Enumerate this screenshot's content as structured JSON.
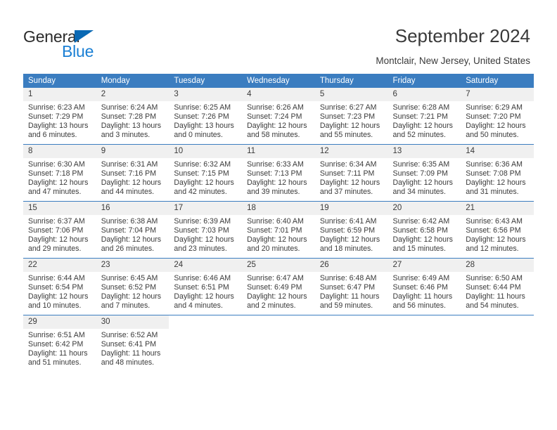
{
  "brand": {
    "name_part1": "General",
    "name_part2": "Blue",
    "triangle_icon": "triangle-icon",
    "accent_color": "#1a7fd4",
    "dark_color": "#2b2b2b"
  },
  "header": {
    "title": "September 2024",
    "subtitle": "Montclair, New Jersey, United States"
  },
  "theme": {
    "header_bg": "#3b7dc0",
    "daynum_bg": "#f0f0f0",
    "text": "#3a3a3a"
  },
  "weekday_headers": [
    "Sunday",
    "Monday",
    "Tuesday",
    "Wednesday",
    "Thursday",
    "Friday",
    "Saturday"
  ],
  "labels": {
    "sunrise": "Sunrise:",
    "sunset": "Sunset:",
    "daylight": "Daylight:"
  },
  "weeks": [
    [
      {
        "day": "1",
        "sunrise": "Sunrise: 6:23 AM",
        "sunset": "Sunset: 7:29 PM",
        "daylight": "Daylight: 13 hours and 6 minutes."
      },
      {
        "day": "2",
        "sunrise": "Sunrise: 6:24 AM",
        "sunset": "Sunset: 7:28 PM",
        "daylight": "Daylight: 13 hours and 3 minutes."
      },
      {
        "day": "3",
        "sunrise": "Sunrise: 6:25 AM",
        "sunset": "Sunset: 7:26 PM",
        "daylight": "Daylight: 13 hours and 0 minutes."
      },
      {
        "day": "4",
        "sunrise": "Sunrise: 6:26 AM",
        "sunset": "Sunset: 7:24 PM",
        "daylight": "Daylight: 12 hours and 58 minutes."
      },
      {
        "day": "5",
        "sunrise": "Sunrise: 6:27 AM",
        "sunset": "Sunset: 7:23 PM",
        "daylight": "Daylight: 12 hours and 55 minutes."
      },
      {
        "day": "6",
        "sunrise": "Sunrise: 6:28 AM",
        "sunset": "Sunset: 7:21 PM",
        "daylight": "Daylight: 12 hours and 52 minutes."
      },
      {
        "day": "7",
        "sunrise": "Sunrise: 6:29 AM",
        "sunset": "Sunset: 7:20 PM",
        "daylight": "Daylight: 12 hours and 50 minutes."
      }
    ],
    [
      {
        "day": "8",
        "sunrise": "Sunrise: 6:30 AM",
        "sunset": "Sunset: 7:18 PM",
        "daylight": "Daylight: 12 hours and 47 minutes."
      },
      {
        "day": "9",
        "sunrise": "Sunrise: 6:31 AM",
        "sunset": "Sunset: 7:16 PM",
        "daylight": "Daylight: 12 hours and 44 minutes."
      },
      {
        "day": "10",
        "sunrise": "Sunrise: 6:32 AM",
        "sunset": "Sunset: 7:15 PM",
        "daylight": "Daylight: 12 hours and 42 minutes."
      },
      {
        "day": "11",
        "sunrise": "Sunrise: 6:33 AM",
        "sunset": "Sunset: 7:13 PM",
        "daylight": "Daylight: 12 hours and 39 minutes."
      },
      {
        "day": "12",
        "sunrise": "Sunrise: 6:34 AM",
        "sunset": "Sunset: 7:11 PM",
        "daylight": "Daylight: 12 hours and 37 minutes."
      },
      {
        "day": "13",
        "sunrise": "Sunrise: 6:35 AM",
        "sunset": "Sunset: 7:09 PM",
        "daylight": "Daylight: 12 hours and 34 minutes."
      },
      {
        "day": "14",
        "sunrise": "Sunrise: 6:36 AM",
        "sunset": "Sunset: 7:08 PM",
        "daylight": "Daylight: 12 hours and 31 minutes."
      }
    ],
    [
      {
        "day": "15",
        "sunrise": "Sunrise: 6:37 AM",
        "sunset": "Sunset: 7:06 PM",
        "daylight": "Daylight: 12 hours and 29 minutes."
      },
      {
        "day": "16",
        "sunrise": "Sunrise: 6:38 AM",
        "sunset": "Sunset: 7:04 PM",
        "daylight": "Daylight: 12 hours and 26 minutes."
      },
      {
        "day": "17",
        "sunrise": "Sunrise: 6:39 AM",
        "sunset": "Sunset: 7:03 PM",
        "daylight": "Daylight: 12 hours and 23 minutes."
      },
      {
        "day": "18",
        "sunrise": "Sunrise: 6:40 AM",
        "sunset": "Sunset: 7:01 PM",
        "daylight": "Daylight: 12 hours and 20 minutes."
      },
      {
        "day": "19",
        "sunrise": "Sunrise: 6:41 AM",
        "sunset": "Sunset: 6:59 PM",
        "daylight": "Daylight: 12 hours and 18 minutes."
      },
      {
        "day": "20",
        "sunrise": "Sunrise: 6:42 AM",
        "sunset": "Sunset: 6:58 PM",
        "daylight": "Daylight: 12 hours and 15 minutes."
      },
      {
        "day": "21",
        "sunrise": "Sunrise: 6:43 AM",
        "sunset": "Sunset: 6:56 PM",
        "daylight": "Daylight: 12 hours and 12 minutes."
      }
    ],
    [
      {
        "day": "22",
        "sunrise": "Sunrise: 6:44 AM",
        "sunset": "Sunset: 6:54 PM",
        "daylight": "Daylight: 12 hours and 10 minutes."
      },
      {
        "day": "23",
        "sunrise": "Sunrise: 6:45 AM",
        "sunset": "Sunset: 6:52 PM",
        "daylight": "Daylight: 12 hours and 7 minutes."
      },
      {
        "day": "24",
        "sunrise": "Sunrise: 6:46 AM",
        "sunset": "Sunset: 6:51 PM",
        "daylight": "Daylight: 12 hours and 4 minutes."
      },
      {
        "day": "25",
        "sunrise": "Sunrise: 6:47 AM",
        "sunset": "Sunset: 6:49 PM",
        "daylight": "Daylight: 12 hours and 2 minutes."
      },
      {
        "day": "26",
        "sunrise": "Sunrise: 6:48 AM",
        "sunset": "Sunset: 6:47 PM",
        "daylight": "Daylight: 11 hours and 59 minutes."
      },
      {
        "day": "27",
        "sunrise": "Sunrise: 6:49 AM",
        "sunset": "Sunset: 6:46 PM",
        "daylight": "Daylight: 11 hours and 56 minutes."
      },
      {
        "day": "28",
        "sunrise": "Sunrise: 6:50 AM",
        "sunset": "Sunset: 6:44 PM",
        "daylight": "Daylight: 11 hours and 54 minutes."
      }
    ],
    [
      {
        "day": "29",
        "sunrise": "Sunrise: 6:51 AM",
        "sunset": "Sunset: 6:42 PM",
        "daylight": "Daylight: 11 hours and 51 minutes."
      },
      {
        "day": "30",
        "sunrise": "Sunrise: 6:52 AM",
        "sunset": "Sunset: 6:41 PM",
        "daylight": "Daylight: 11 hours and 48 minutes."
      },
      {
        "day": "",
        "sunrise": "",
        "sunset": "",
        "daylight": ""
      },
      {
        "day": "",
        "sunrise": "",
        "sunset": "",
        "daylight": ""
      },
      {
        "day": "",
        "sunrise": "",
        "sunset": "",
        "daylight": ""
      },
      {
        "day": "",
        "sunrise": "",
        "sunset": "",
        "daylight": ""
      },
      {
        "day": "",
        "sunrise": "",
        "sunset": "",
        "daylight": ""
      }
    ]
  ]
}
